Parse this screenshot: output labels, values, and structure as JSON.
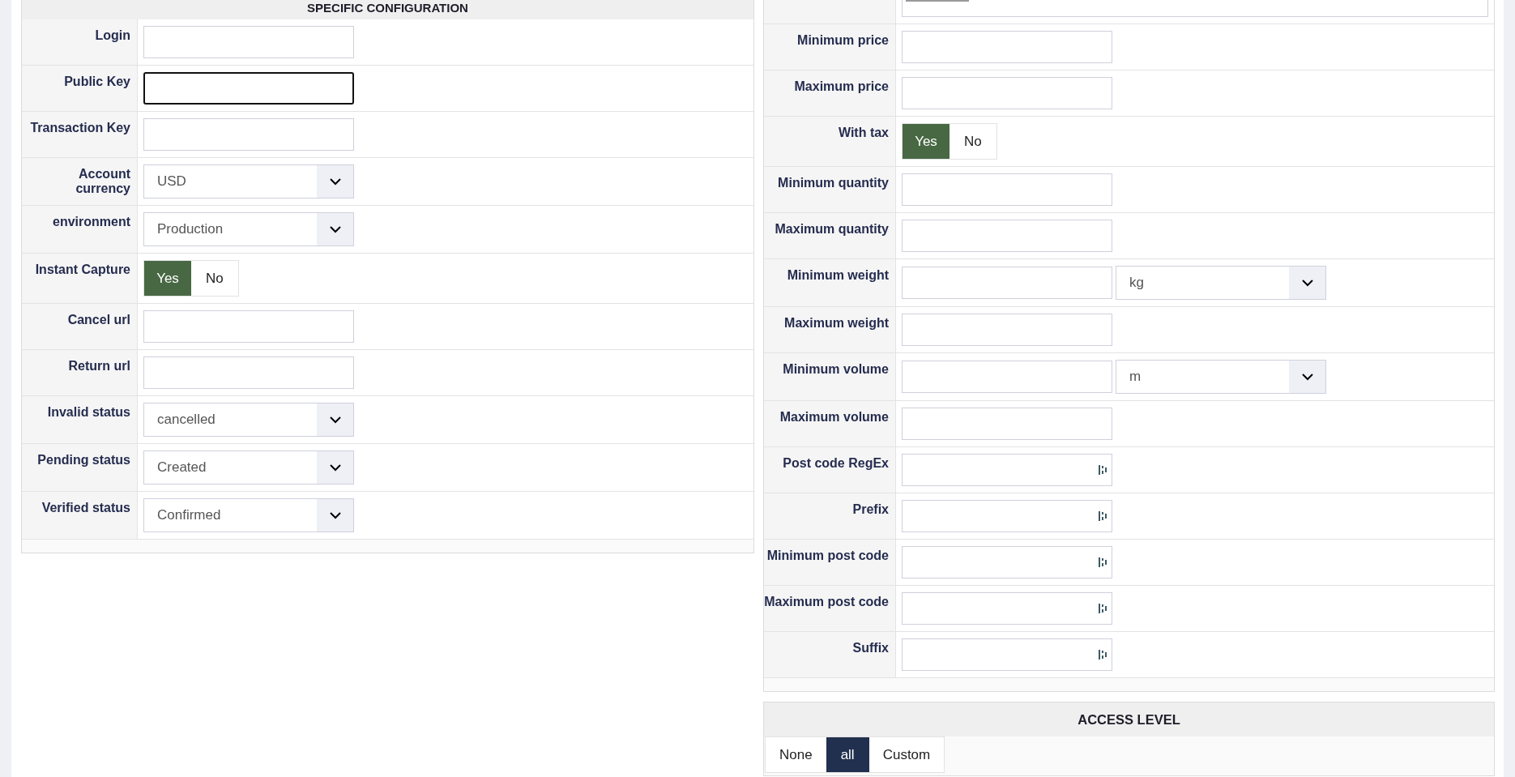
{
  "left_panel": {
    "title": "SPECIFIC CONFIGURATION",
    "rows": [
      {
        "label": "Login",
        "kind": "text",
        "focused": false
      },
      {
        "label": "Public Key",
        "kind": "text",
        "focused": true
      },
      {
        "label": "Transaction Key",
        "kind": "text",
        "focused": false
      },
      {
        "label": "Account currency",
        "kind": "select",
        "value": "USD"
      },
      {
        "label": "environment",
        "kind": "select",
        "value": "Production"
      },
      {
        "label": "Instant Capture",
        "kind": "toggle",
        "options": [
          {
            "label": "Yes",
            "selected": true
          },
          {
            "label": "No",
            "selected": false
          }
        ]
      },
      {
        "label": "Cancel url",
        "kind": "text",
        "focused": false
      },
      {
        "label": "Return url",
        "kind": "text",
        "focused": false
      },
      {
        "label": "Invalid status",
        "kind": "select",
        "value": "cancelled"
      },
      {
        "label": "Pending status",
        "kind": "select",
        "value": "Created"
      },
      {
        "label": "Verified status",
        "kind": "select",
        "value": "Confirmed"
      }
    ]
  },
  "right_panel": {
    "rows": [
      {
        "kind": "partial"
      },
      {
        "label": "Minimum price",
        "kind": "text",
        "focused": false
      },
      {
        "label": "Maximum price",
        "kind": "text",
        "focused": false
      },
      {
        "label": "With tax",
        "kind": "toggle",
        "options": [
          {
            "label": "Yes",
            "selected": true
          },
          {
            "label": "No",
            "selected": false
          }
        ]
      },
      {
        "label": "Minimum quantity",
        "kind": "text",
        "focused": false
      },
      {
        "label": "Maximum quantity",
        "kind": "text",
        "focused": false
      },
      {
        "label": "Minimum weight",
        "kind": "unit",
        "unit": "kg"
      },
      {
        "label": "Maximum weight",
        "kind": "text",
        "focused": false
      },
      {
        "label": "Minimum volume",
        "kind": "unit",
        "unit": "m"
      },
      {
        "label": "Maximum volume",
        "kind": "text",
        "focused": false
      },
      {
        "label": "Post code RegEx",
        "kind": "icon_text"
      },
      {
        "label": "Prefix",
        "kind": "icon_text"
      },
      {
        "label": "Minimum post code",
        "kind": "icon_text"
      },
      {
        "label": "Maximum post code",
        "kind": "icon_text"
      },
      {
        "label": "Suffix",
        "kind": "icon_text"
      }
    ]
  },
  "access_level": {
    "title": "ACCESS LEVEL",
    "options": [
      {
        "label": "None",
        "selected": false
      },
      {
        "label": "all",
        "selected": true
      },
      {
        "label": "Custom",
        "selected": false
      }
    ]
  }
}
